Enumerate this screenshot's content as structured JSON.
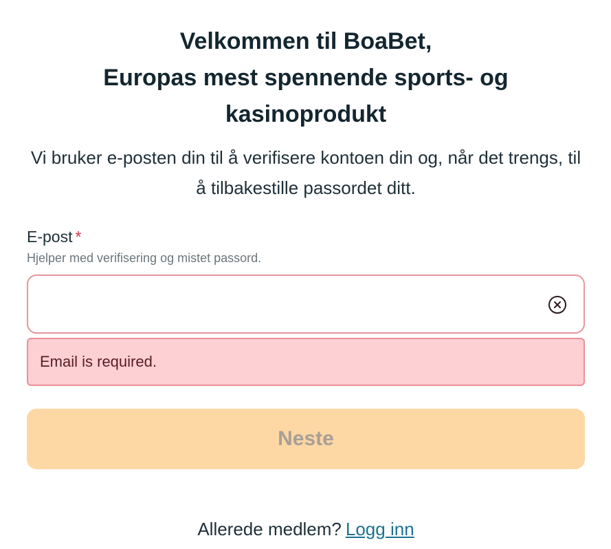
{
  "header": {
    "title_line_1": "Velkommen til BoaBet,",
    "title_line_2": "Europas mest spennende sports- og",
    "title_line_3": "kasinoprodukt",
    "subtitle": "Vi bruker e-posten din til å verifisere kontoen din og, når det trengs, til å tilbakestille passordet ditt."
  },
  "email_field": {
    "label": "E-post",
    "required_marker": "*",
    "helper": "Hjelper med verifisering og mistet passord.",
    "value": "",
    "placeholder": "",
    "clear_icon": "close-circle-icon",
    "error": "Email is required."
  },
  "actions": {
    "submit_label": "Neste",
    "submit_disabled": true
  },
  "footer": {
    "prompt": "Allerede medlem?",
    "login_link": "Logg inn"
  },
  "colors": {
    "accent_disabled": "#fdd7a4",
    "error_border": "#e7959d",
    "error_background": "#fdd0d3",
    "link": "#1d7290",
    "required": "#d0344a"
  }
}
